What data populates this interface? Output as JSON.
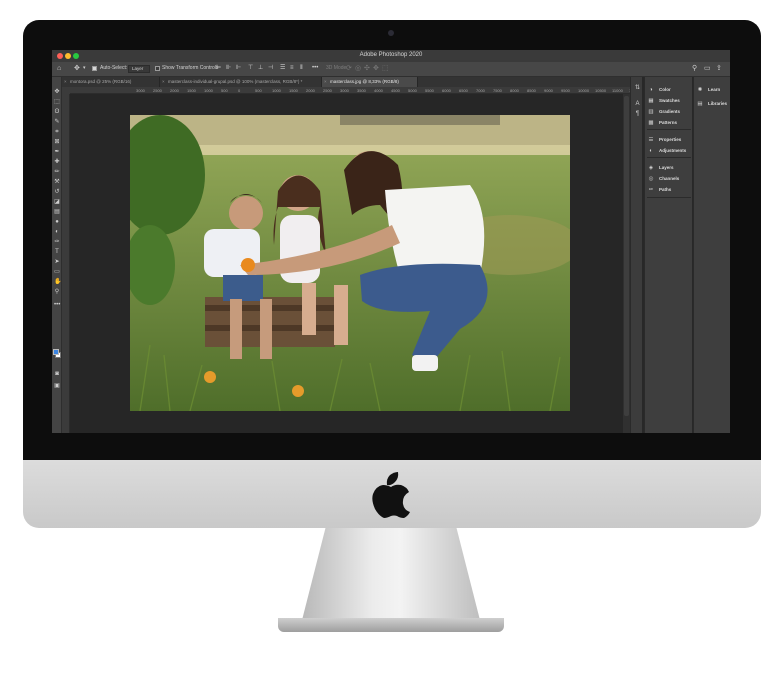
{
  "window": {
    "title": "Adobe Photoshop 2020"
  },
  "options_bar": {
    "auto_select_label": "Auto-Select:",
    "auto_select_value": "Layer",
    "show_transform_label": "Show Transform Controls",
    "mode_3d_label": "3D Mode:"
  },
  "tabs": [
    {
      "label": "montora.psd @ 25% (RGB/16)"
    },
    {
      "label": "masterclass-individual-grupal.psd @ 100% (masterclass, RGB/8*) *"
    },
    {
      "label": "masterclass.jpg @ 8,33% (RGB/8)"
    }
  ],
  "ruler_numbers": [
    "3000",
    "2500",
    "2000",
    "1500",
    "1000",
    "500",
    "0",
    "500",
    "1000",
    "1500",
    "2000",
    "2500",
    "3000",
    "3500",
    "4000",
    "4500",
    "5000",
    "5500",
    "6000",
    "6500",
    "7000",
    "7500",
    "8000",
    "8500",
    "9000",
    "9500",
    "10000",
    "10500",
    "11000",
    "11500",
    "12000",
    "125"
  ],
  "panels": [
    {
      "label": "Color",
      "icon": "color-wheel-icon"
    },
    {
      "label": "Swatches",
      "icon": "swatches-grid-icon"
    },
    {
      "label": "Gradients",
      "icon": "gradient-icon"
    },
    {
      "label": "Patterns",
      "icon": "patterns-icon"
    },
    {
      "label": "Properties",
      "icon": "properties-sliders-icon"
    },
    {
      "label": "Adjustments",
      "icon": "adjustments-icon"
    },
    {
      "label": "Layers",
      "icon": "layers-icon"
    },
    {
      "label": "Channels",
      "icon": "channels-icon"
    },
    {
      "label": "Paths",
      "icon": "paths-icon"
    }
  ],
  "panels_secondary": [
    {
      "label": "Learn",
      "icon": "learn-bulb-icon"
    },
    {
      "label": "Libraries",
      "icon": "libraries-icon"
    }
  ],
  "colors": {
    "foreground": "#3b84e0",
    "background": "#ffffff",
    "ui_dark": "#282828",
    "ui_panel": "#3e3e3e"
  }
}
